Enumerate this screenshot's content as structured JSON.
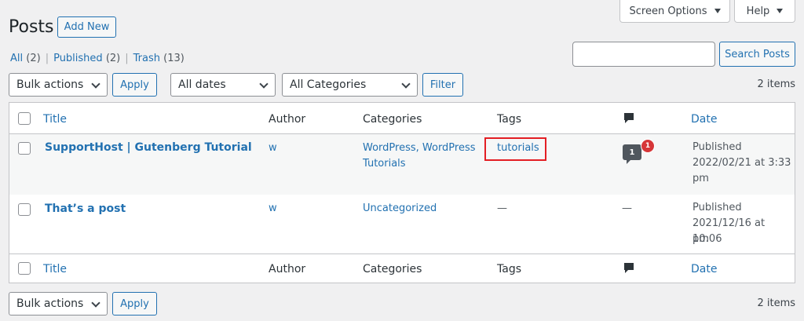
{
  "header": {
    "screen_options": "Screen Options",
    "help": "Help",
    "title": "Posts",
    "add_new": "Add New"
  },
  "filters_links": {
    "all": "All",
    "all_count": "(2)",
    "published": "Published",
    "published_count": "(2)",
    "trash": "Trash",
    "trash_count": "(13)",
    "separator": "|"
  },
  "search": {
    "value": "",
    "button": "Search Posts"
  },
  "toolbar_top": {
    "bulk_actions": "Bulk actions",
    "apply": "Apply",
    "dates": "All dates",
    "categories": "All Categories",
    "filter": "Filter",
    "items": "2 items"
  },
  "columns": {
    "title": "Title",
    "author": "Author",
    "categories": "Categories",
    "tags": "Tags",
    "date": "Date"
  },
  "rows": [
    {
      "title": "SupportHost | Gutenberg Tutorial",
      "author": "w",
      "categories_line1": "WordPress, WordPress",
      "categories_line2": "Tutorials",
      "tag": "tutorials",
      "comments": "1",
      "pending": "1",
      "status": "Published",
      "date_line1": "2022/02/21 at 3:33",
      "date_line2": "pm"
    },
    {
      "title": "That’s a post",
      "author": "w",
      "categories_line1": "Uncategorized",
      "tag": "—",
      "comments": "—",
      "status": "Published",
      "date_line1": "2021/12/16 at 10:06",
      "date_line2": "pm"
    }
  ],
  "toolbar_bottom": {
    "bulk_actions": "Bulk actions",
    "apply": "Apply",
    "items": "2 items"
  },
  "colors": {
    "link": "#2271b1",
    "highlight": "#e31e24",
    "pending_badge": "#d63638"
  }
}
